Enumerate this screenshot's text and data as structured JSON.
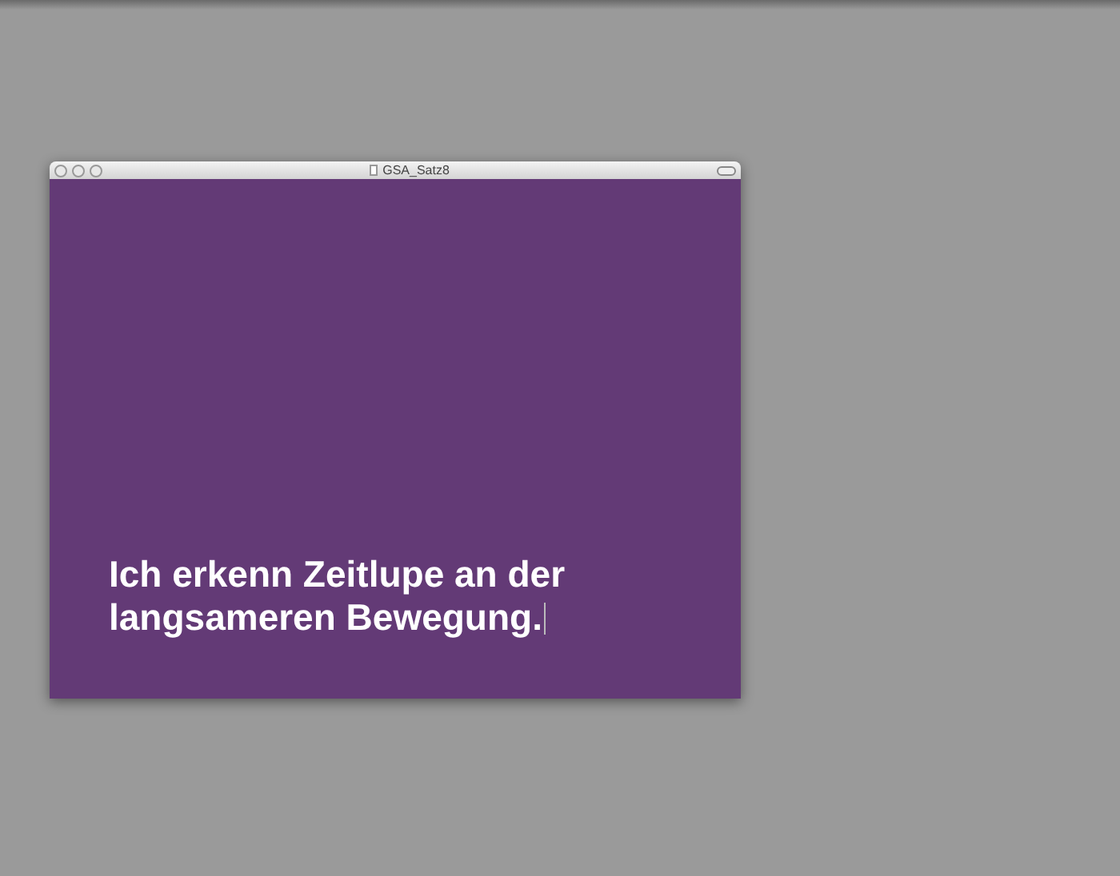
{
  "window": {
    "title": "GSA_Satz8"
  },
  "slide": {
    "text": "Ich erkenn Zeitlupe an der langsameren Bewegung."
  }
}
